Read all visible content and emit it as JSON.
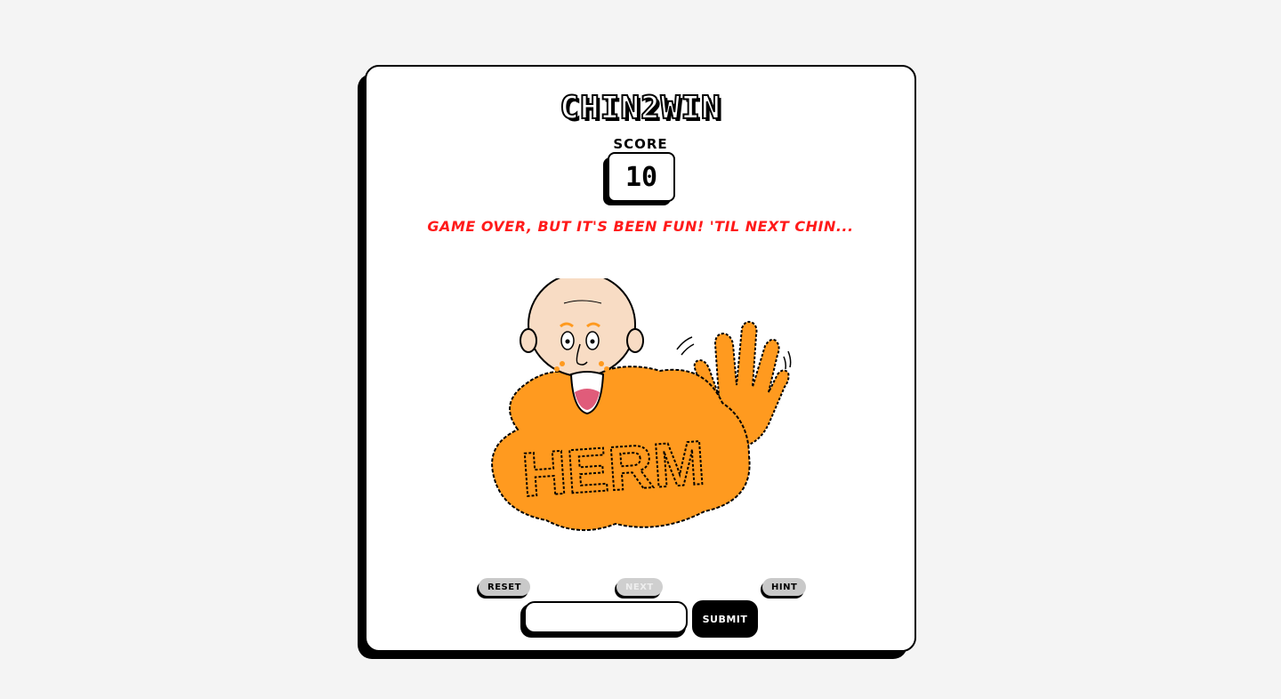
{
  "game": {
    "title": "CHIN2WIN",
    "score_label": "SCORE",
    "score": "10",
    "message": "GAME OVER, BUT IT'S BEEN FUN! 'TIL NEXT CHIN...",
    "character_name": "HERM"
  },
  "controls": {
    "reset_label": "RESET",
    "next_label": "NEXT",
    "hint_label": "HINT",
    "submit_label": "SUBMIT",
    "answer_value": "",
    "answer_placeholder": ""
  },
  "colors": {
    "background": "#f4f4f4",
    "message": "#ff1a1a",
    "beard": "#ff9a1f",
    "skin": "#f8dcc4"
  }
}
